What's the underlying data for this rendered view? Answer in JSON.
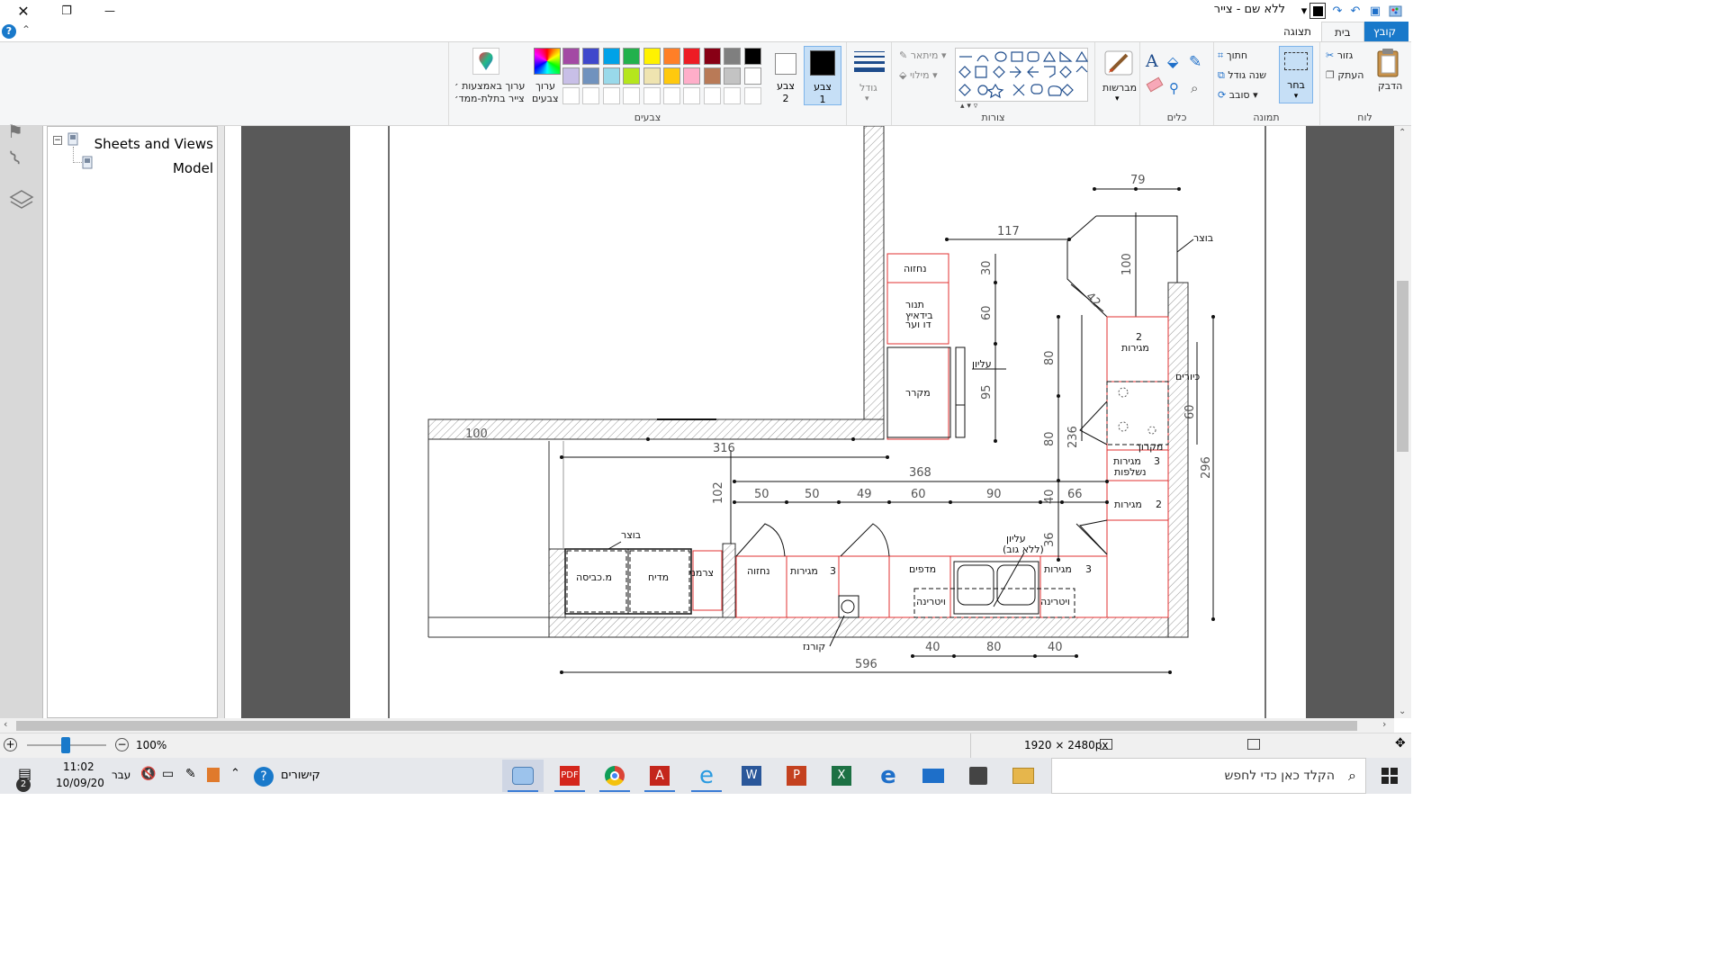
{
  "window": {
    "title": "ללא שם - צייר",
    "close_glyph": "✕",
    "max_glyph": "❐",
    "min_glyph": "—"
  },
  "tabs": [
    {
      "label": "קובץ"
    },
    {
      "label": "בית"
    },
    {
      "label": "תצוגה"
    }
  ],
  "ribbon": {
    "clipboard": {
      "label": "לוח",
      "paste": "הדבק",
      "cut": "גזור",
      "copy": "העתק"
    },
    "image": {
      "label": "תמונה",
      "select": "בחר",
      "crop": "חתוך",
      "resize": "שנה גודל",
      "rotate": "סובב"
    },
    "tools": {
      "label": "כלים"
    },
    "brushes": {
      "label": "מברשות"
    },
    "shapes": {
      "label": "צורות",
      "outline": "מיתאר",
      "fill": "מילוי"
    },
    "size": {
      "label": "גודל"
    },
    "colors": {
      "label": "צבעים",
      "color1": "צבע",
      "color1_num": "1",
      "color2": "צבע",
      "color2_num": "2",
      "edit": "ערוך",
      "edit2": "צבעים",
      "paint3d_1": "ערוך באמצעות ׳",
      "paint3d_2": "צייר בתלת-ממד׳",
      "palette_row1": [
        "#000000",
        "#7f7f7f",
        "#880015",
        "#ed1c24",
        "#ff7f27",
        "#fff200",
        "#22b14c",
        "#00a2e8",
        "#3f48cc",
        "#a349a4"
      ],
      "palette_row2": [
        "#ffffff",
        "#c3c3c3",
        "#b97a57",
        "#ffaec9",
        "#ffc90e",
        "#efe4b0",
        "#b5e61d",
        "#99d9ea",
        "#7092be",
        "#c8bfe7"
      ]
    }
  },
  "nav": {
    "root": "Sheets and Views",
    "child": "Model"
  },
  "drawing": {
    "labels": {
      "bottom_left_butzar": "בוצר",
      "top_right_butzar": "בוצר",
      "kiyorim": "כיורים",
      "mikroh": "מקרוך",
      "kurnaz": "קורנז",
      "wall_100": "100",
      "nidzova_top": "נחזוה",
      "tanur_line1": "תנור",
      "tanur_line2": "בידאיץ",
      "tanur_line3": "דו וער",
      "mekarer": "מקרר",
      "eliyun": "עליון",
      "cab_mikhvisa": "מ.כביסה",
      "cab_mediah": "מדיח",
      "cab_tzarmani": "צרמני",
      "cab_nidzova": "נחזוה",
      "cab_megirot1": "מגירות",
      "cab_megirot_num1": "3",
      "cab_madpim": "מדפים",
      "cab_megirot2": "מגירות",
      "cab_megirot_num2": "3",
      "cab_vitrina1": "ויטרינה",
      "cab_vitrina2": "ויטרינה",
      "eliyun2": "עליון",
      "eliyun2b": "(ללא גוב)",
      "r_megirot1": "מגירות",
      "r_megirot_num1": "2",
      "r_megirot2": "מגירות",
      "r_megirot_num2": "3",
      "r_nashlfot": "נשלפות",
      "r_megirot3": "מגירות",
      "r_megirot_num3": "2"
    },
    "dims": {
      "d79": "79",
      "d117": "117",
      "d100": "100",
      "d42": "42",
      "d30": "30",
      "d60": "60",
      "d95": "95",
      "d80a": "80",
      "d80b": "80",
      "d236": "236",
      "d36": "36",
      "d60r": "60",
      "d296": "296",
      "d316": "316",
      "d368": "368",
      "d102": "102",
      "d50a": "50",
      "d50b": "50",
      "d49": "49",
      "d90": "90",
      "d40": "40",
      "d66": "66",
      "d40b": "40",
      "d80c": "80",
      "d40c": "40",
      "d596": "596"
    }
  },
  "status": {
    "dimensions": "1920 × 2480px",
    "zoom": "100%"
  },
  "taskbar": {
    "search": "הקלד כאן כדי לחפש",
    "time": "11:02",
    "date": "10/09/20",
    "lang": "עבר",
    "links": "קישורים",
    "notif_count": "2"
  }
}
